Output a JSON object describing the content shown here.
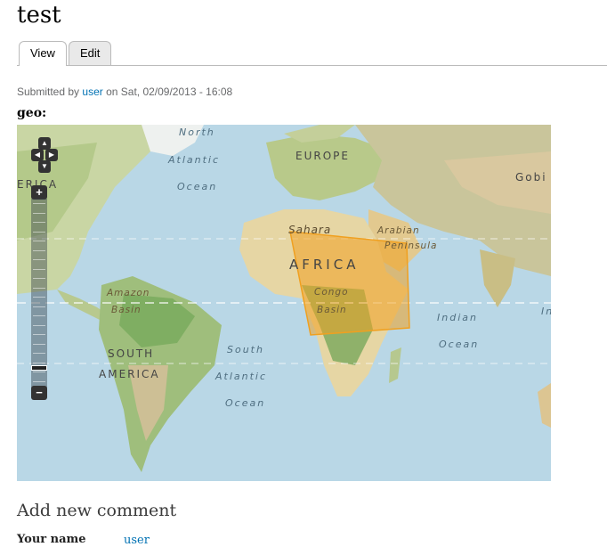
{
  "node": {
    "title": "test",
    "tabs": [
      {
        "label": "View",
        "active": true
      },
      {
        "label": "Edit",
        "active": false
      }
    ],
    "submitted": {
      "prefix": "Submitted by",
      "author": "user",
      "suffix": "on Sat, 02/09/2013 - 16:08"
    },
    "field_label": "geo:"
  },
  "map": {
    "labels": {
      "north": "North",
      "atlantic1": "Atlantic",
      "ocean1": "Ocean",
      "europe": "EUROPE",
      "america_n": "ERICA",
      "gobi": "Gobi",
      "sahara": "Sahara",
      "arabian": "Arabian",
      "peninsula": "Peninsula",
      "africa": "AFRICA",
      "congo": "Congo",
      "basin": "Basin",
      "amazon": "Amazon",
      "amazon_basin": "Basin",
      "indian": "Indian",
      "ocean_indian": "Ocean",
      "india_partial": "In",
      "south_america_1": "SOUTH",
      "south_america_2": "AMERICA",
      "south": "South",
      "atlantic2": "Atlantic",
      "ocean2": "Ocean"
    },
    "polygon_color": "#f0a020",
    "controls": {
      "zoom_in": "+",
      "zoom_out": "−",
      "pan_up": "▲",
      "pan_down": "▼",
      "pan_left": "◀",
      "pan_right": "▶",
      "zoom_level_fraction": 0.9
    }
  },
  "comment": {
    "heading": "Add new comment",
    "name_label": "Your name",
    "name_value": "user"
  }
}
